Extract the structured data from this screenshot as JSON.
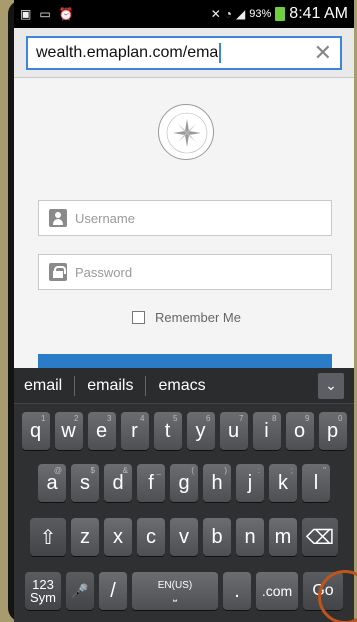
{
  "status_bar": {
    "battery": "93%",
    "time": "8:41 AM"
  },
  "url_bar": {
    "url": "wealth.emaplan.com/ema",
    "clear_symbol": "✕"
  },
  "login": {
    "username_placeholder": "Username",
    "password_placeholder": "Password",
    "remember_label": "Remember Me"
  },
  "keyboard": {
    "suggestions": [
      "email",
      "emails",
      "emacs"
    ],
    "row1": [
      {
        "k": "q",
        "a": "1"
      },
      {
        "k": "w",
        "a": "2"
      },
      {
        "k": "e",
        "a": "3"
      },
      {
        "k": "r",
        "a": "4"
      },
      {
        "k": "t",
        "a": "5"
      },
      {
        "k": "y",
        "a": "6"
      },
      {
        "k": "u",
        "a": "7"
      },
      {
        "k": "i",
        "a": "8"
      },
      {
        "k": "o",
        "a": "9"
      },
      {
        "k": "p",
        "a": "0"
      }
    ],
    "row2": [
      {
        "k": "a",
        "a": "@"
      },
      {
        "k": "s",
        "a": "$"
      },
      {
        "k": "d",
        "a": "&"
      },
      {
        "k": "f",
        "a": "_"
      },
      {
        "k": "g",
        "a": "("
      },
      {
        "k": "h",
        "a": ")"
      },
      {
        "k": "j",
        "a": ":"
      },
      {
        "k": "k",
        "a": ";"
      },
      {
        "k": "l",
        "a": "\""
      }
    ],
    "row3": [
      {
        "k": "z",
        "a": ""
      },
      {
        "k": "x",
        "a": ""
      },
      {
        "k": "c",
        "a": ""
      },
      {
        "k": "v",
        "a": ""
      },
      {
        "k": "b",
        "a": ""
      },
      {
        "k": "n",
        "a": ""
      },
      {
        "k": "m",
        "a": ""
      }
    ],
    "sym_label_top": "123",
    "sym_label_bottom": "Sym",
    "slash": "/",
    "space_label": "EN(US)",
    "dot": ".",
    "com": ".com",
    "go": "Go",
    "shift_icon": "⇧",
    "backspace_icon": "⌫",
    "mic_icon": "🎤",
    "expand_icon": "⌄"
  }
}
